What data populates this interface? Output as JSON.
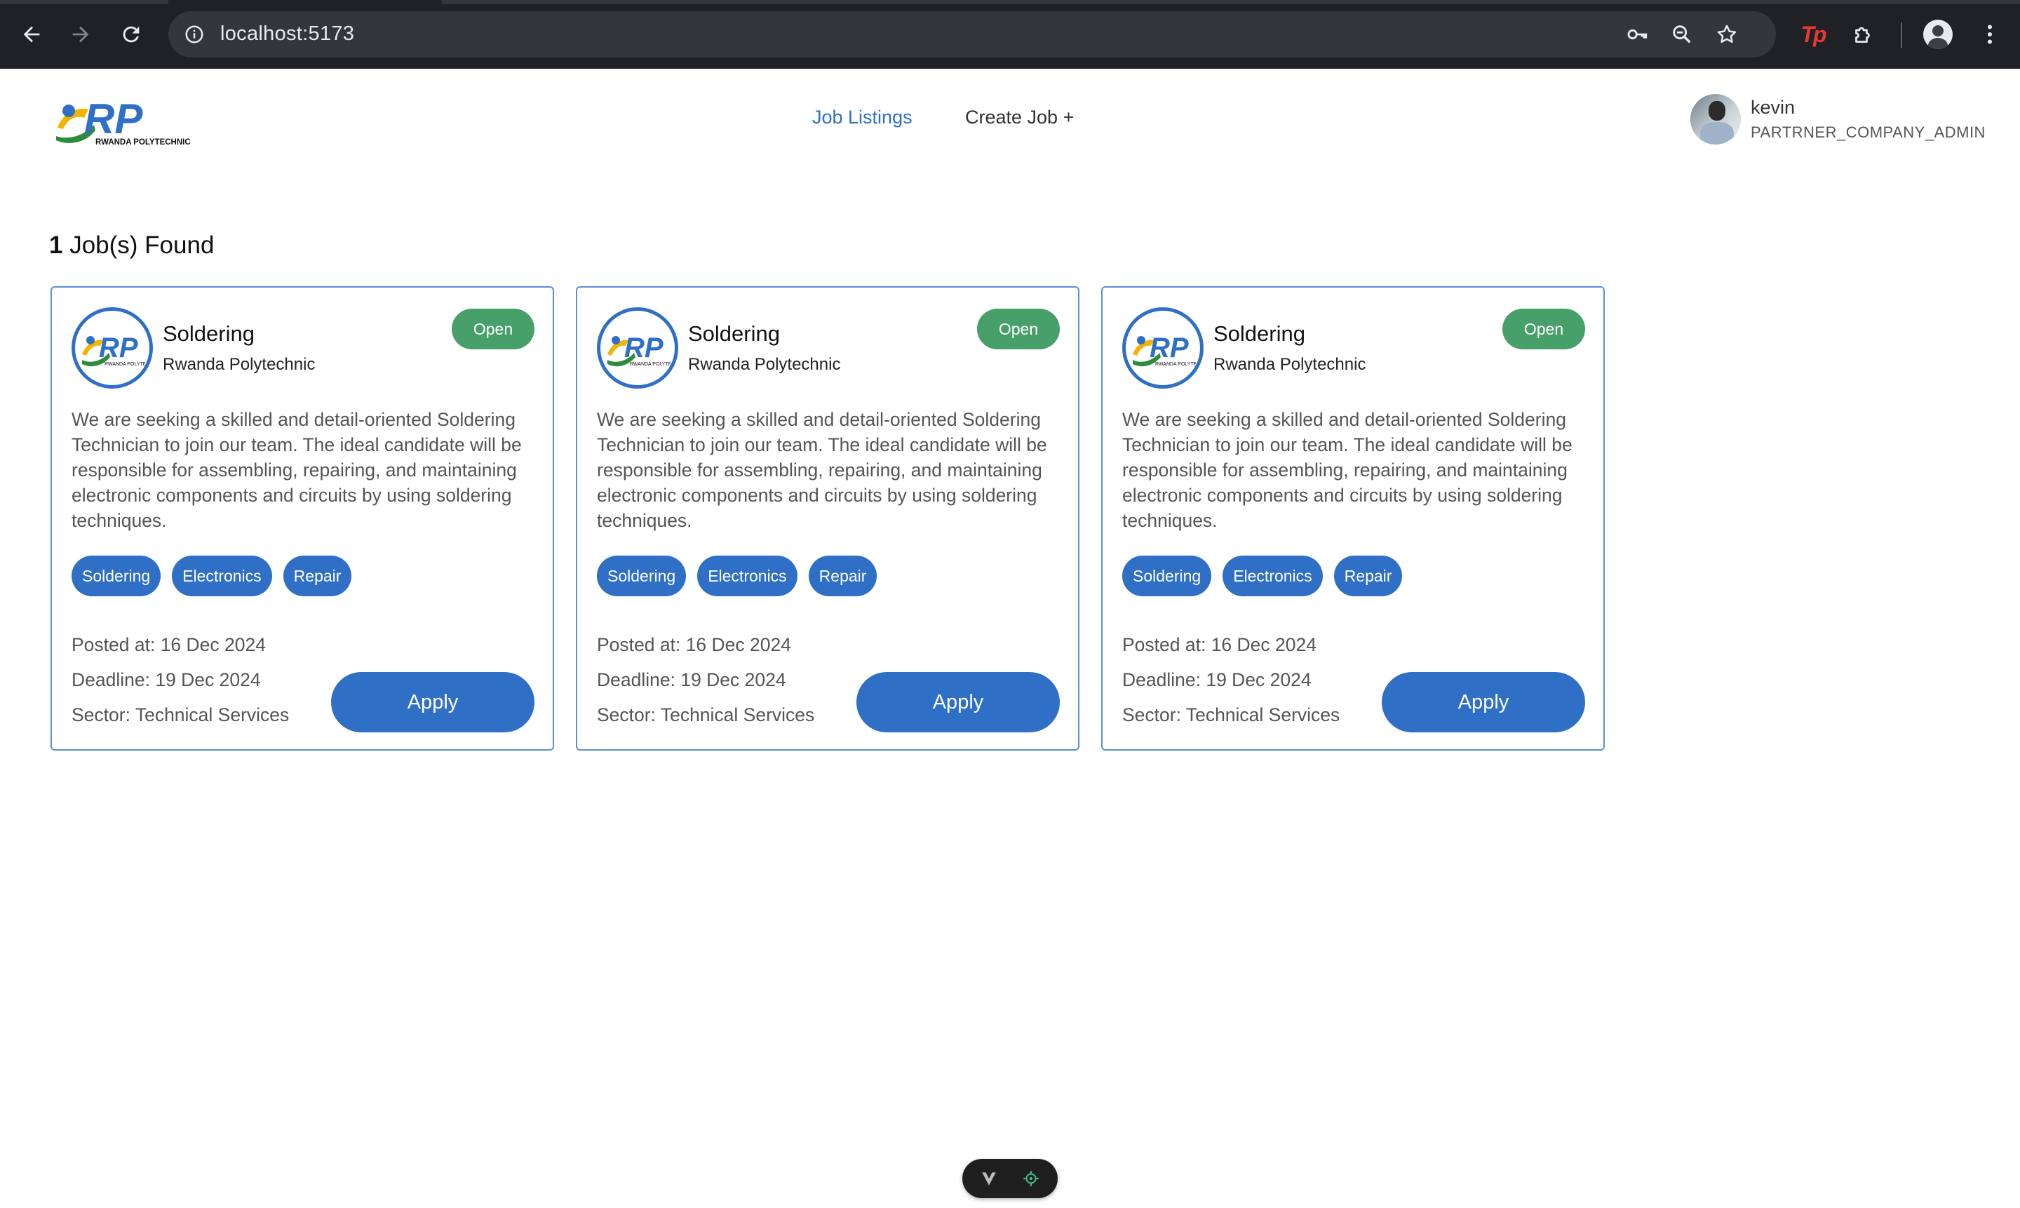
{
  "browser": {
    "url": "localhost:5173",
    "colors": {
      "frame": "#202124",
      "omnibox": "#35363a",
      "icon": "#e8eaed"
    },
    "icons": [
      "back-icon",
      "forward-icon",
      "reload-icon",
      "site-info-icon",
      "password-key-icon",
      "zoom-icon",
      "bookmark-star-icon",
      "tp-extension-icon",
      "extensions-puzzle-icon",
      "profile-avatar-icon",
      "more-menu-icon"
    ]
  },
  "header": {
    "logo_text": "RWANDA POLYTECHNIC",
    "nav": [
      {
        "label": "Job Listings",
        "active": true
      },
      {
        "label": "Create Job +",
        "active": false
      }
    ],
    "user": {
      "name": "kevin",
      "role": "PARTRNER_COMPANY_ADMIN"
    }
  },
  "results": {
    "count": "1",
    "label": "Job(s) Found"
  },
  "jobs": [
    {
      "title": "Soldering",
      "company": "Rwanda Polytechnic",
      "status": "Open",
      "description": "We are seeking a skilled and detail-oriented Soldering Technician to join our team. The ideal candidate will be responsible for assembling, repairing, and maintaining electronic components and circuits by using soldering techniques.",
      "tags": [
        "Soldering",
        "Electronics",
        "Repair"
      ],
      "posted": "Posted at: 16 Dec 2024",
      "deadline": "Deadline: 19 Dec 2024",
      "sector": "Sector: Technical Services",
      "apply_label": "Apply"
    },
    {
      "title": "Soldering",
      "company": "Rwanda Polytechnic",
      "status": "Open",
      "description": "We are seeking a skilled and detail-oriented Soldering Technician to join our team. The ideal candidate will be responsible for assembling, repairing, and maintaining electronic components and circuits by using soldering techniques.",
      "tags": [
        "Soldering",
        "Electronics",
        "Repair"
      ],
      "posted": "Posted at: 16 Dec 2024",
      "deadline": "Deadline: 19 Dec 2024",
      "sector": "Sector: Technical Services",
      "apply_label": "Apply"
    },
    {
      "title": "Soldering",
      "company": "Rwanda Polytechnic",
      "status": "Open",
      "description": "We are seeking a skilled and detail-oriented Soldering Technician to join our team. The ideal candidate will be responsible for assembling, repairing, and maintaining electronic components and circuits by using soldering techniques.",
      "tags": [
        "Soldering",
        "Electronics",
        "Repair"
      ],
      "posted": "Posted at: 16 Dec 2024",
      "deadline": "Deadline: 19 Dec 2024",
      "sector": "Sector: Technical Services",
      "apply_label": "Apply"
    }
  ],
  "theme": {
    "primary": "#2f6fc6",
    "status_open": "#47a06a",
    "card_border": "#5b8fd6",
    "muted_text": "#555555"
  }
}
